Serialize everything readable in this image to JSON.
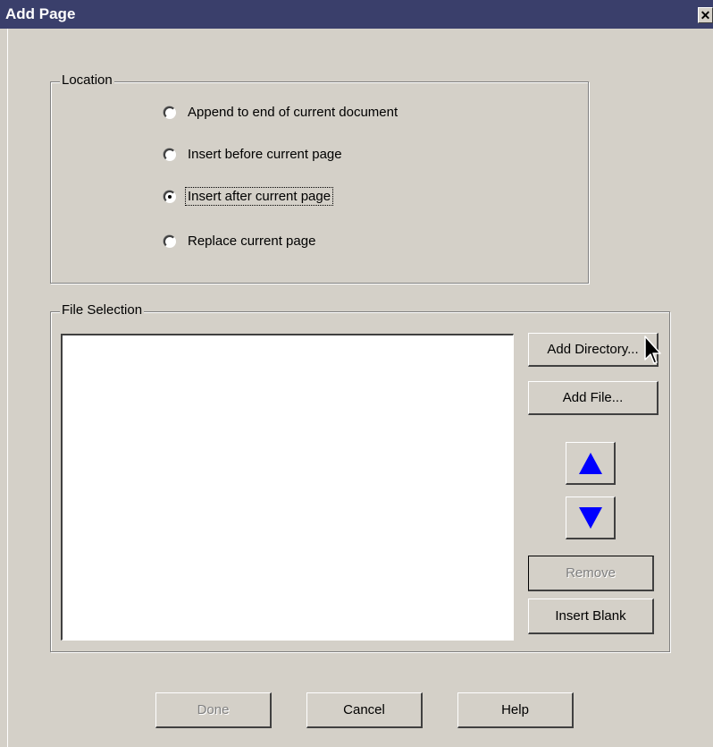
{
  "window": {
    "title": "Add Page",
    "close_symbol": "✕"
  },
  "location": {
    "legend": "Location",
    "options": [
      {
        "label": "Append to end of current document",
        "checked": false
      },
      {
        "label": "Insert before current page",
        "checked": false
      },
      {
        "label": "Insert after current page",
        "checked": true
      },
      {
        "label": "Replace current page",
        "checked": false
      }
    ]
  },
  "file_selection": {
    "legend": "File Selection",
    "items": [],
    "add_directory_label": "Add Directory...",
    "add_file_label": "Add File...",
    "move_up_icon": "up-arrow-icon",
    "move_down_icon": "down-arrow-icon",
    "remove_label": "Remove",
    "insert_blank_label": "Insert Blank"
  },
  "footer": {
    "done_label": "Done",
    "cancel_label": "Cancel",
    "help_label": "Help"
  },
  "colors": {
    "titlebar": "#3a3f6b",
    "face": "#d4d0c8",
    "arrow": "#0000ff"
  }
}
